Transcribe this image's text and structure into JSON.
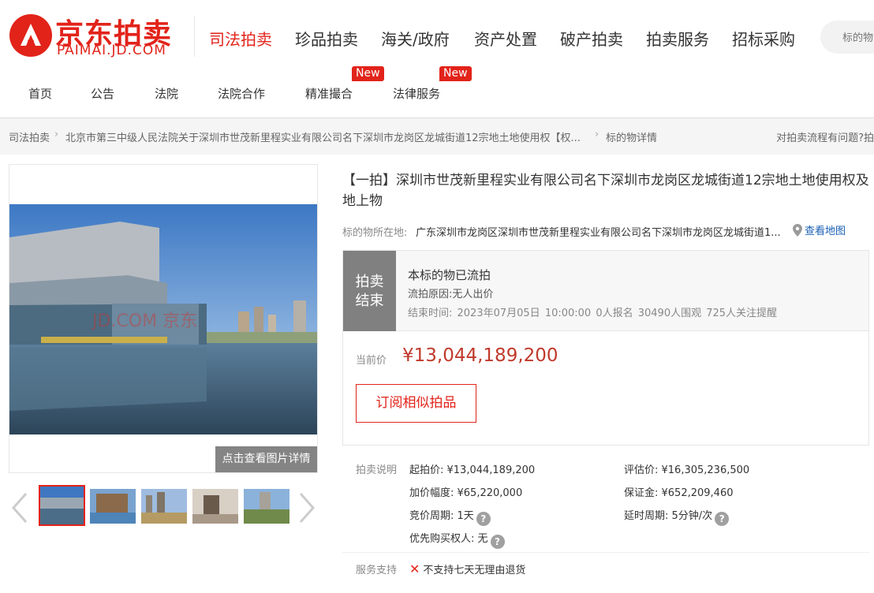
{
  "brand": {
    "name_cn": "京东拍卖",
    "name_en": "PAIMAI.JD.COM",
    "color": "#e2231a"
  },
  "nav": {
    "categories": [
      "司法拍卖",
      "珍品拍卖",
      "海关/政府",
      "资产处置",
      "破产拍卖",
      "拍卖服务",
      "招标采购"
    ],
    "search_placeholder": "标的物",
    "sub": [
      "首页",
      "公告",
      "法院",
      "法院合作",
      "精准撮合",
      "法律服务"
    ],
    "new_badge": "New"
  },
  "breadcrumb": {
    "items": [
      "司法拍卖",
      "北京市第三中级人民法院关于深圳市世茂新里程实业有限公司名下深圳市龙岗区龙城街道12宗地土地使用权【权...",
      "标的物详情"
    ],
    "help": "对拍卖流程有问题?拍"
  },
  "gallery": {
    "watermark": "JD.COM 京东",
    "detail_button": "点击查看图片详情",
    "thumbnail_count": 5,
    "selected_index": 0
  },
  "item": {
    "title": "【一拍】深圳市世茂新里程实业有限公司名下深圳市龙岗区龙城街道12宗地土地使用权及地上物",
    "location_label": "标的物所在地:",
    "location": "广东深圳市龙岗区深圳市世茂新里程实业有限公司名下深圳市龙岗区龙城街道1...",
    "map_link": "查看地图",
    "status": {
      "box_line1": "拍卖",
      "box_line2": "结束",
      "main": "本标的物已流拍",
      "reason": "流拍原因:无人出价",
      "end_time": "结束时间: 2023年07月05日 10:00:00 0人报名 30490人围观 725人关注提醒"
    },
    "price_label": "当前价",
    "price": "¥13,044,189,200",
    "subscribe_button": "订阅相似拍品",
    "params_label": "拍卖说明",
    "params": {
      "start_price": "起拍价: ¥13,044,189,200",
      "valuation": "评估价: ¥16,305,236,500",
      "increment": "加价幅度: ¥65,220,000",
      "deposit": "保证金: ¥652,209,460",
      "cycle": "竞价周期: 1天",
      "delay": "延时周期: 5分钟/次",
      "priority": "优先购买权人: 无"
    },
    "service_label": "服务支持",
    "service": "不支持七天无理由退货"
  }
}
